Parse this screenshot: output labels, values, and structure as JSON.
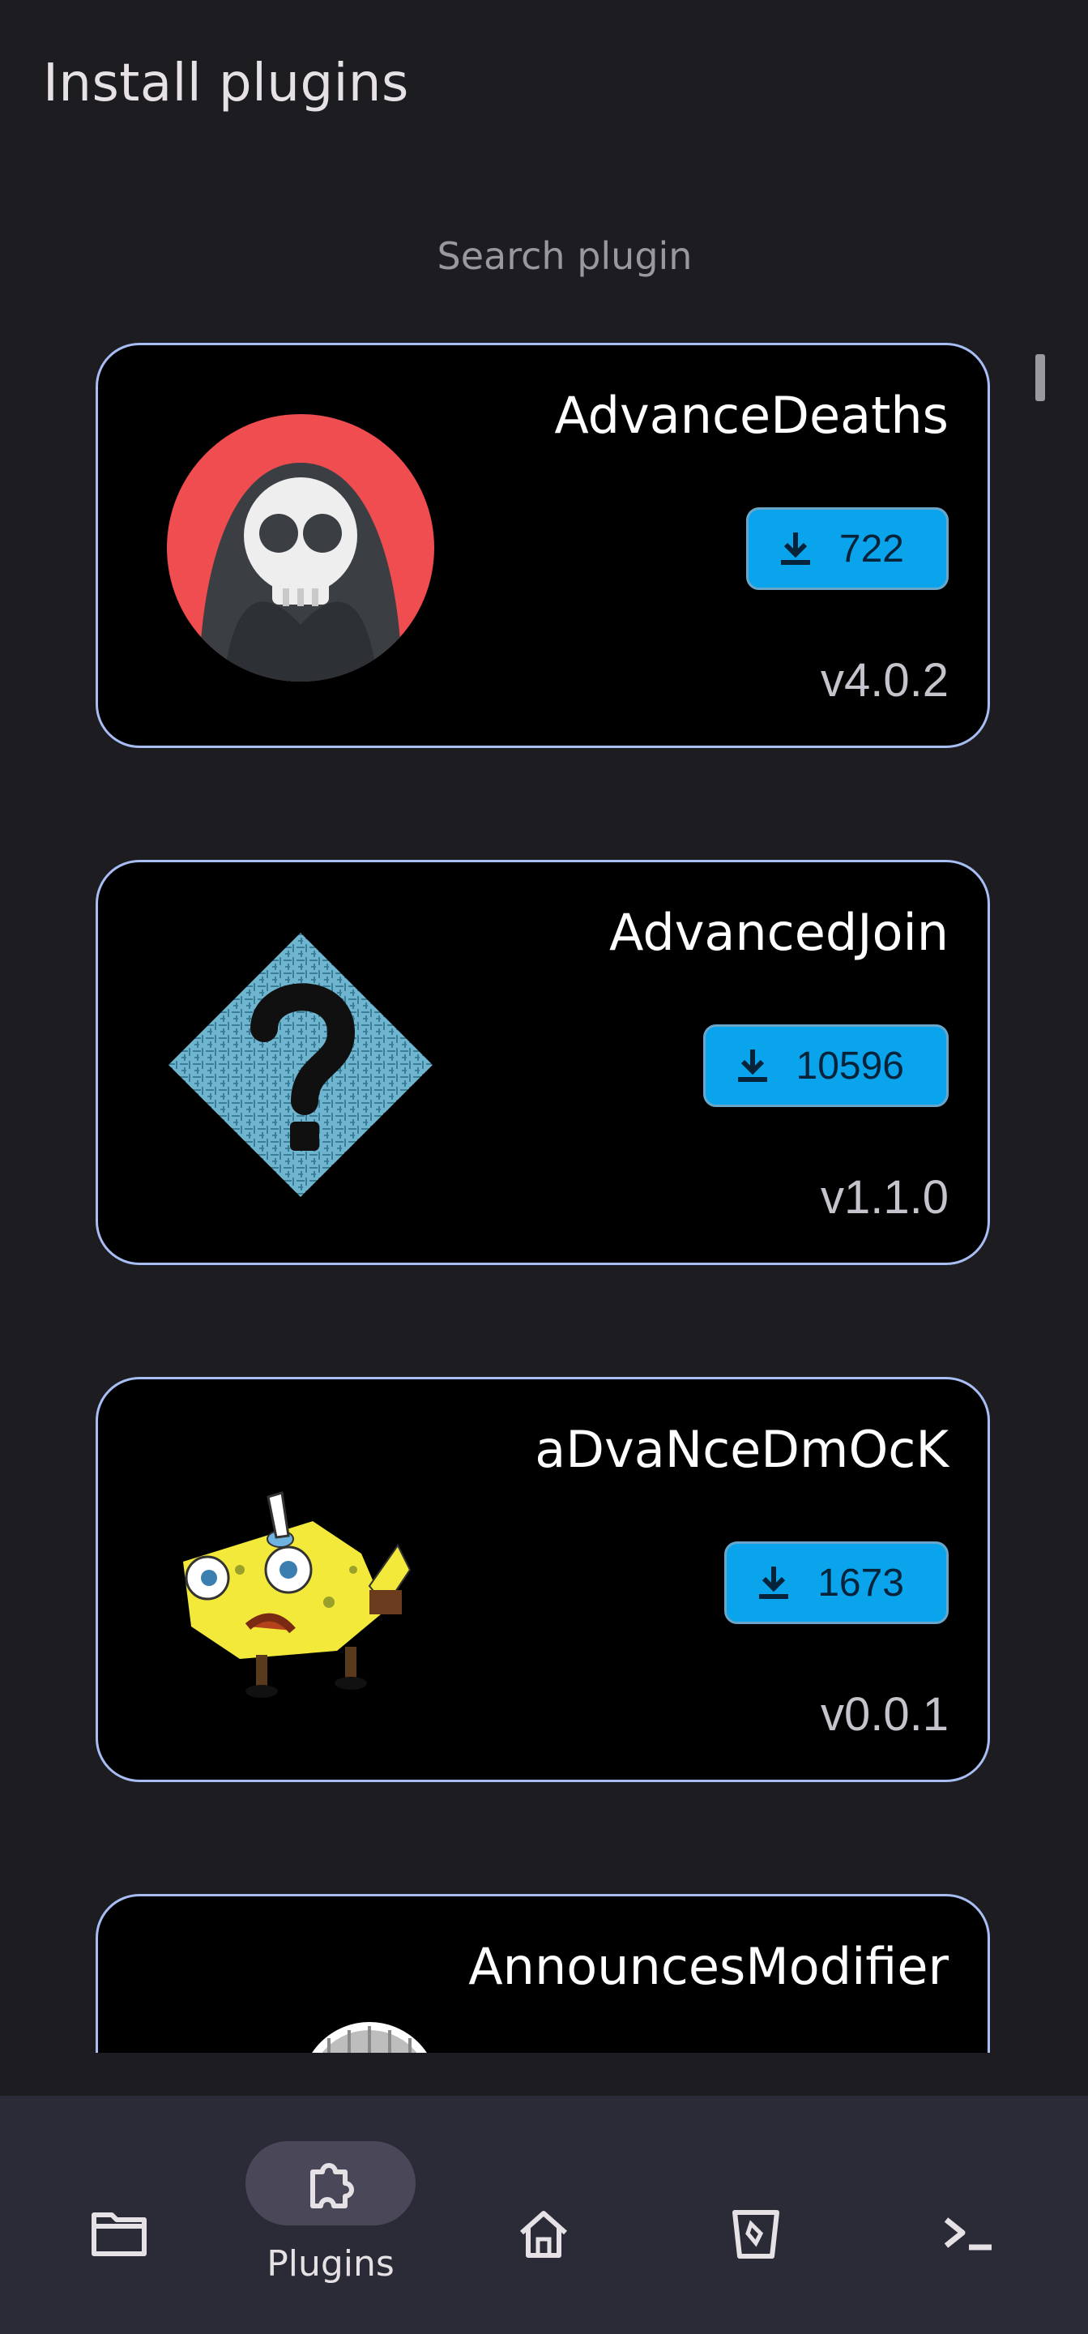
{
  "header": {
    "title": "Install plugins"
  },
  "search": {
    "placeholder": "Search plugin"
  },
  "plugins": [
    {
      "name": "AdvanceDeaths",
      "downloads": "722",
      "version": "v4.0.2",
      "logo_icon": "hooded-skull-icon"
    },
    {
      "name": "AdvancedJoin",
      "downloads": "10596",
      "version": "v1.1.0",
      "logo_icon": "question-diamond-icon"
    },
    {
      "name": "aDvaNceDmOcK",
      "downloads": "1673",
      "version": "v0.0.1",
      "logo_icon": "mocking-sponge-icon"
    },
    {
      "name": "AnnouncesModifier",
      "logo_icon": "racket-icon"
    }
  ],
  "bottom_nav": {
    "items": [
      {
        "id": "files",
        "icon": "folder-icon",
        "label": ""
      },
      {
        "id": "plugins",
        "icon": "puzzle-icon",
        "label": "Plugins",
        "selected": true
      },
      {
        "id": "home",
        "icon": "home-icon",
        "label": ""
      },
      {
        "id": "backup",
        "icon": "bucket-icon",
        "label": ""
      },
      {
        "id": "console",
        "icon": "terminal-icon",
        "label": ""
      }
    ]
  },
  "colors": {
    "background": "#1d1c21",
    "card_background": "#000000",
    "card_border": "#a7bdf3",
    "download_button": "#0aa4ec",
    "nav_background": "#2a2b37",
    "nav_selected_pill": "#4a4758"
  }
}
